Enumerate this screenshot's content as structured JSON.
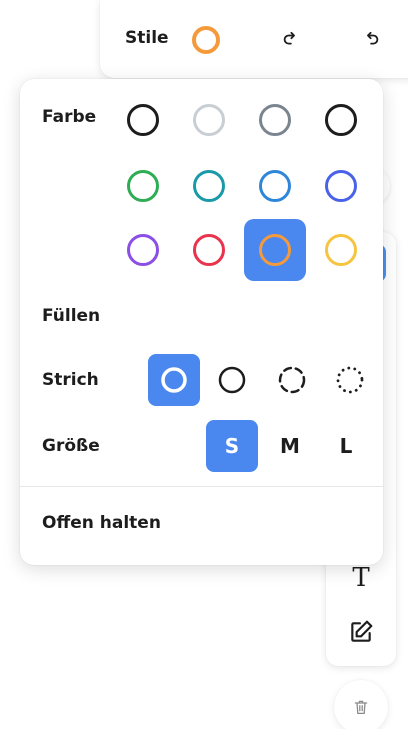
{
  "toolbar": {
    "styles_label": "Stile",
    "current_color": "#f59a3a"
  },
  "panel": {
    "color_label": "Farbe",
    "colors": [
      {
        "name": "black",
        "hex": "#1d1d1d"
      },
      {
        "name": "light-grey",
        "hex": "#c9ced5"
      },
      {
        "name": "grey",
        "hex": "#7b8590"
      },
      {
        "name": "black-2",
        "hex": "#1d1d1d"
      },
      {
        "name": "green",
        "hex": "#2ead55"
      },
      {
        "name": "teal",
        "hex": "#1a9aa8"
      },
      {
        "name": "blue",
        "hex": "#2f86d8"
      },
      {
        "name": "indigo",
        "hex": "#4a62e8"
      },
      {
        "name": "violet",
        "hex": "#8b4fe6"
      },
      {
        "name": "red",
        "hex": "#e8344d"
      },
      {
        "name": "orange",
        "hex": "#f59a3a"
      },
      {
        "name": "yellow",
        "hex": "#f5c542"
      }
    ],
    "selected_color_index": 10,
    "fill_label": "Füllen",
    "stroke_label": "Strich",
    "stroke_options": [
      "solid-bold",
      "solid",
      "dashed",
      "dotted"
    ],
    "selected_stroke_index": 0,
    "size_label": "Größe",
    "sizes": [
      "S",
      "M",
      "L"
    ],
    "selected_size_index": 0,
    "keep_open_label": "Offen halten"
  },
  "right_tools": {
    "text_icon": "text-icon",
    "note_icon": "note-edit-icon",
    "trash_icon": "trash-icon",
    "text_glyph": "T"
  },
  "accent": "#4a88f0"
}
